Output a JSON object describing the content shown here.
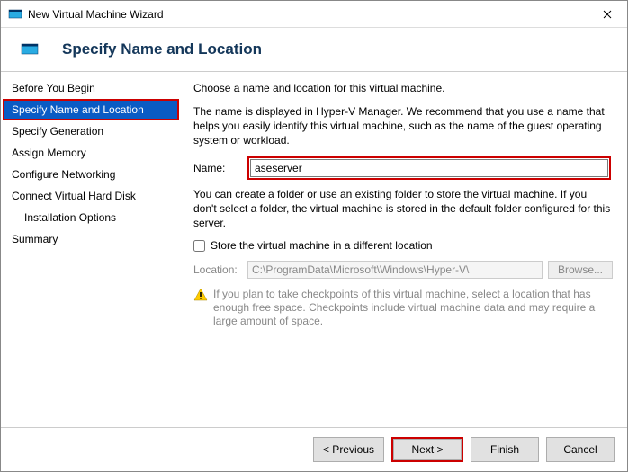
{
  "window": {
    "title": "New Virtual Machine Wizard"
  },
  "header": {
    "heading": "Specify Name and Location"
  },
  "sidebar": {
    "items": [
      {
        "label": "Before You Begin"
      },
      {
        "label": "Specify Name and Location"
      },
      {
        "label": "Specify Generation"
      },
      {
        "label": "Assign Memory"
      },
      {
        "label": "Configure Networking"
      },
      {
        "label": "Connect Virtual Hard Disk"
      },
      {
        "label": "Installation Options"
      },
      {
        "label": "Summary"
      }
    ],
    "active_index": 1
  },
  "main": {
    "intro": "Choose a name and location for this virtual machine.",
    "desc": "The name is displayed in Hyper-V Manager. We recommend that you use a name that helps you easily identify this virtual machine, such as the name of the guest operating system or workload.",
    "name_label": "Name:",
    "name_value": "aseserver",
    "folder_desc": "You can create a folder or use an existing folder to store the virtual machine. If you don't select a folder, the virtual machine is stored in the default folder configured for this server.",
    "checkbox_label": "Store the virtual machine in a different location",
    "checkbox_checked": false,
    "location_label": "Location:",
    "location_value": "C:\\ProgramData\\Microsoft\\Windows\\Hyper-V\\",
    "browse_label": "Browse...",
    "warning": "If you plan to take checkpoints of this virtual machine, select a location that has enough free space. Checkpoints include virtual machine data and may require a large amount of space."
  },
  "footer": {
    "previous": "< Previous",
    "next": "Next >",
    "finish": "Finish",
    "cancel": "Cancel"
  }
}
